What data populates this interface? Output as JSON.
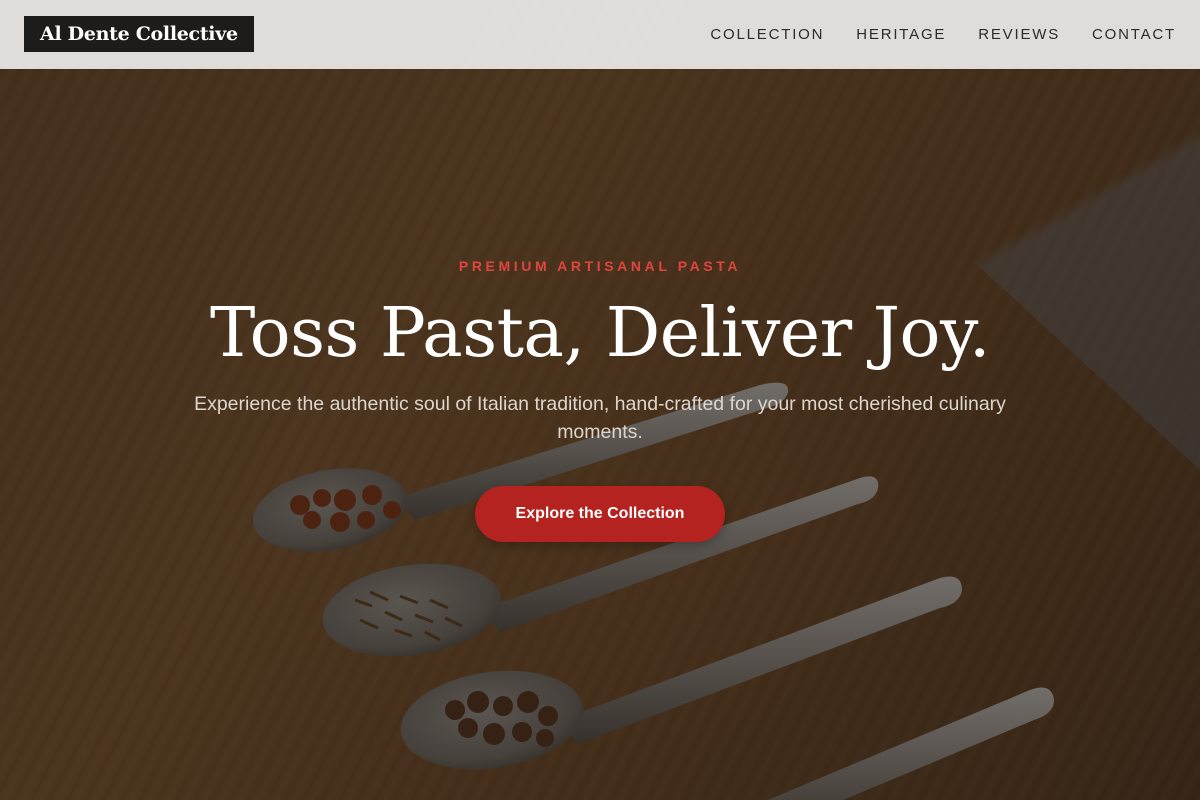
{
  "header": {
    "brand": "Al Dente Collective",
    "nav": [
      {
        "label": "COLLECTION"
      },
      {
        "label": "HERITAGE"
      },
      {
        "label": "REVIEWS"
      },
      {
        "label": "CONTACT"
      }
    ]
  },
  "hero": {
    "eyebrow": "PREMIUM ARTISANAL PASTA",
    "headline": "Toss Pasta, Deliver Joy.",
    "subtitle": "Experience the authentic soul of Italian tradition, hand-crafted for your most cherished culinary moments.",
    "cta_label": "Explore the Collection"
  },
  "colors": {
    "accent": "#b4231f",
    "eyebrow": "#e0463d",
    "brand_bg": "#1e1c1b",
    "header_bg": "#eceae8"
  }
}
